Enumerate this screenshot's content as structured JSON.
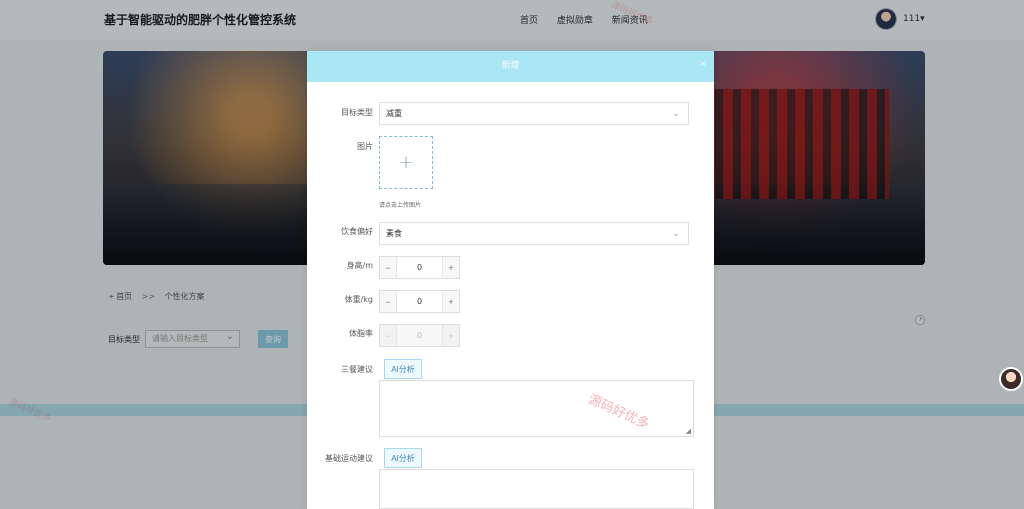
{
  "header": {
    "title": "基于智能驱动的肥胖个性化管控系统",
    "nav": [
      "首页",
      "虚拟勋章",
      "新闻资讯"
    ],
    "user": "111▾",
    "avatar_icon": "user-avatar"
  },
  "background": {
    "breadcrumb": {
      "home": "首页",
      "separator": ">>",
      "current": "个性化方案"
    },
    "filter": {
      "label": "目标类型",
      "placeholder": "请输入目标类型",
      "query_label": "查询"
    },
    "helper_icon": "floating-avatar-icon"
  },
  "modal": {
    "title": "新增",
    "close": "×",
    "fields": {
      "goal_type": {
        "label": "目标类型",
        "value": "减重"
      },
      "image": {
        "label": "图片",
        "hint": "请点击上传图片"
      },
      "diet": {
        "label": "饮食偏好",
        "value": "素食"
      },
      "height": {
        "label": "身高/m",
        "value": "0"
      },
      "weight": {
        "label": "体重/kg",
        "value": "0"
      },
      "body_fat": {
        "label": "体脂率",
        "value": "0"
      },
      "meal_advice": {
        "label": "三餐建议",
        "ai_label": "AI分析"
      },
      "exercise_advice": {
        "label": "基础运动建议",
        "ai_label": "AI分析"
      }
    }
  },
  "watermark": "源码好优多",
  "colors": {
    "modal_header": "#a9e7f5",
    "accent": "#8bc6dd",
    "background": "#dfe7ea"
  }
}
